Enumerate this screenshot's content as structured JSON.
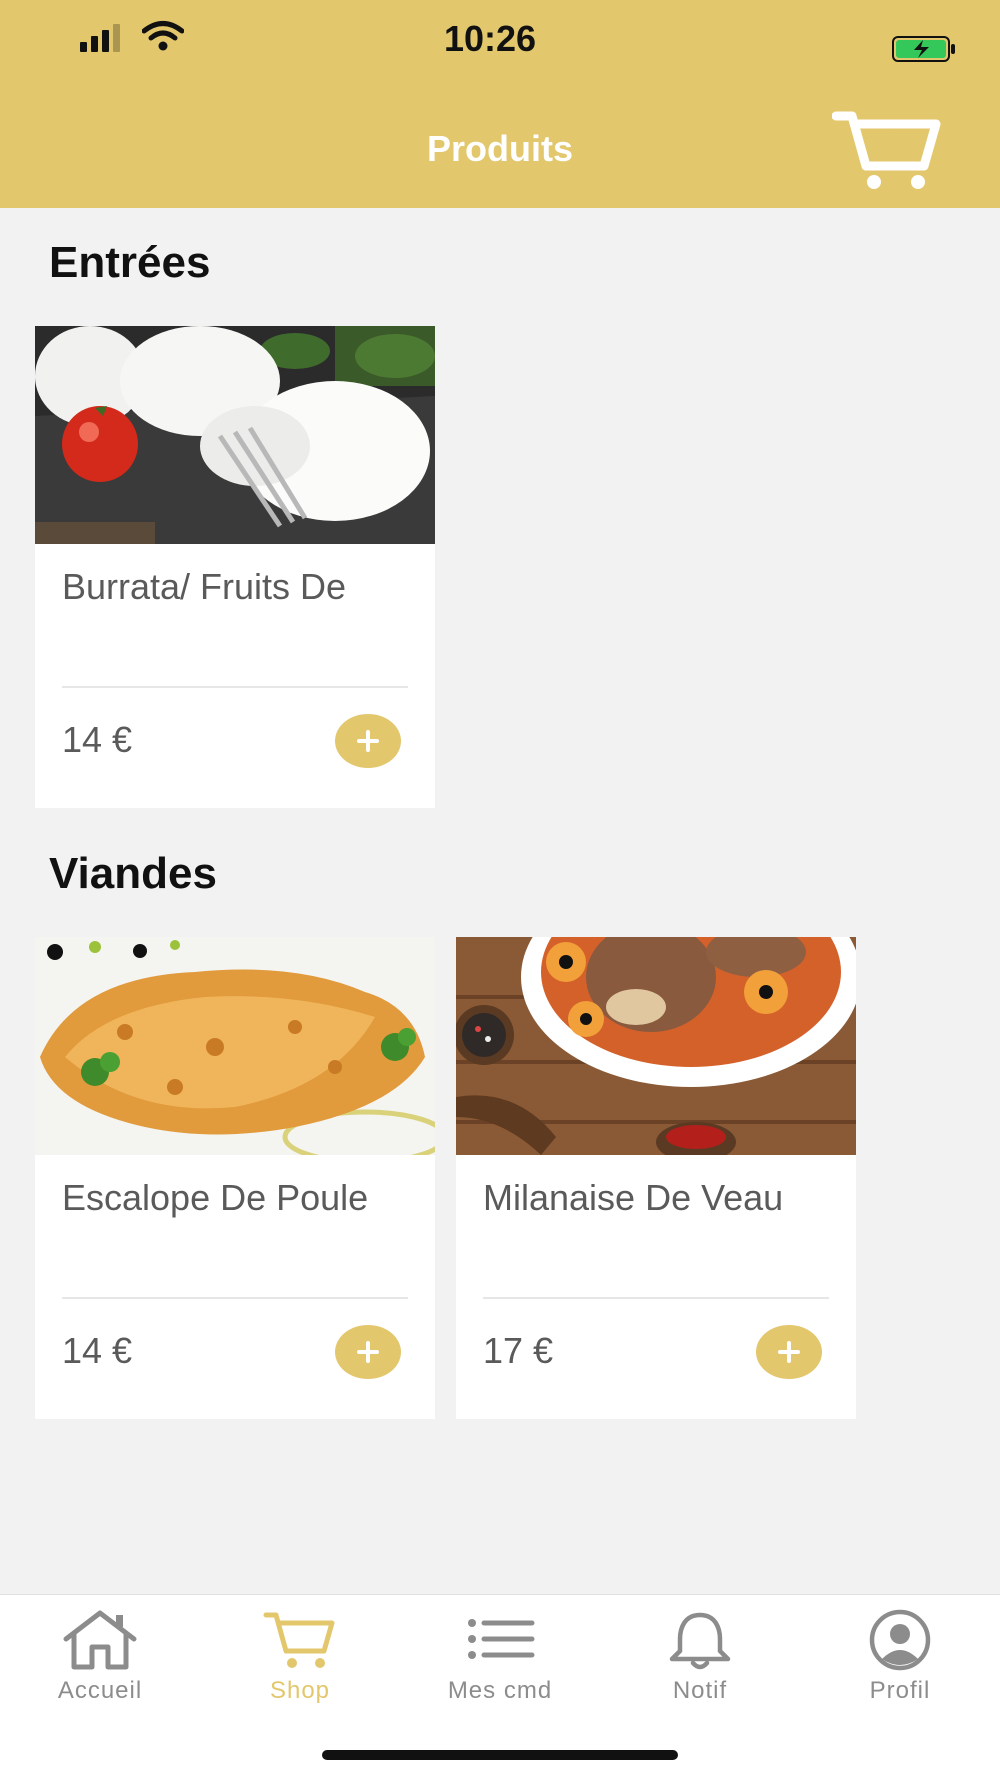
{
  "status_bar": {
    "time": "10:26"
  },
  "header": {
    "title": "Produits",
    "cart_count": "0"
  },
  "sections": [
    {
      "title": "Entrées",
      "products": [
        {
          "name": "Burrata/ Fruits De",
          "price": "14 €"
        }
      ]
    },
    {
      "title": "Viandes",
      "products": [
        {
          "name": "Escalope De Poule",
          "price": "14 €"
        },
        {
          "name": "Milanaise De Veau",
          "price": "17 €"
        }
      ]
    }
  ],
  "tabbar": {
    "items": [
      {
        "label": "Accueil",
        "icon": "home-icon"
      },
      {
        "label": "Shop",
        "icon": "cart-icon",
        "active": true
      },
      {
        "label": "Mes cmd",
        "icon": "list-icon"
      },
      {
        "label": "Notif",
        "icon": "bell-icon"
      },
      {
        "label": "Profil",
        "icon": "user-icon"
      }
    ]
  },
  "colors": {
    "accent": "#e3c76d",
    "background": "#f2f2f2",
    "text": "#5a5a5a"
  }
}
